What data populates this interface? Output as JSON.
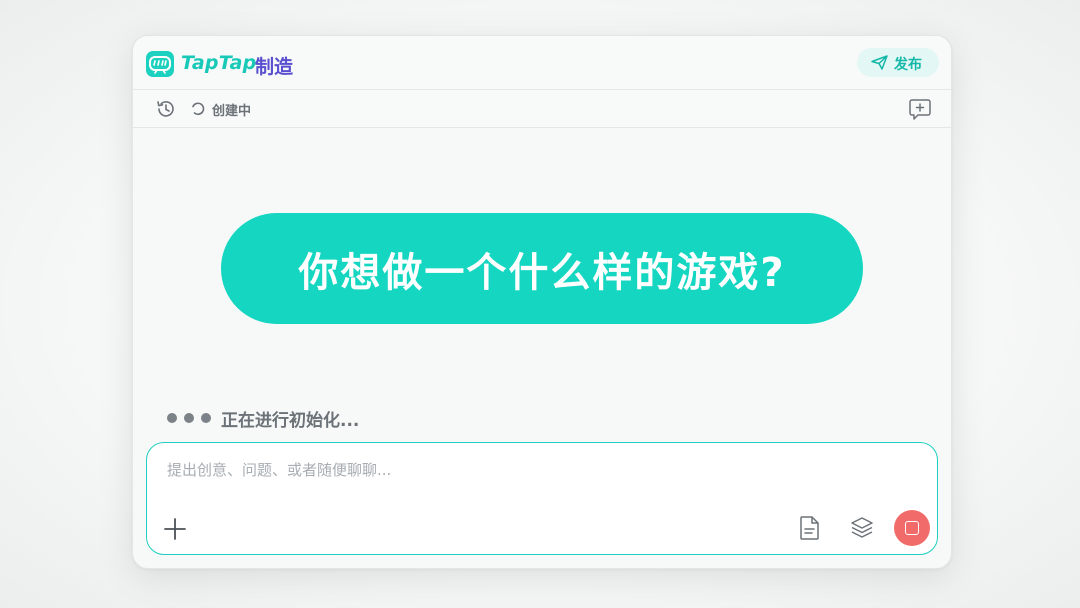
{
  "header": {
    "brand": "TapTap",
    "brand_sub": "制造",
    "publish_label": "发布"
  },
  "toolbar": {
    "status_label": "创建中"
  },
  "main": {
    "hero_text": "你想做一个什么样的游戏?",
    "loading_text": "正在进行初始化..."
  },
  "composer": {
    "placeholder": "提出创意、问题、或者随便聊聊..."
  },
  "colors": {
    "accent": "#14d6c1",
    "brand_purple": "#5a4fcf",
    "stop": "#f26b6b"
  },
  "icons": {
    "logo": "gamepad-logo-icon",
    "publish": "send-icon",
    "history": "history-icon",
    "status": "spinner-icon",
    "new_chat": "new-chat-icon",
    "add": "plus-icon",
    "document": "document-icon",
    "layers": "layers-icon",
    "stop": "stop-icon"
  }
}
